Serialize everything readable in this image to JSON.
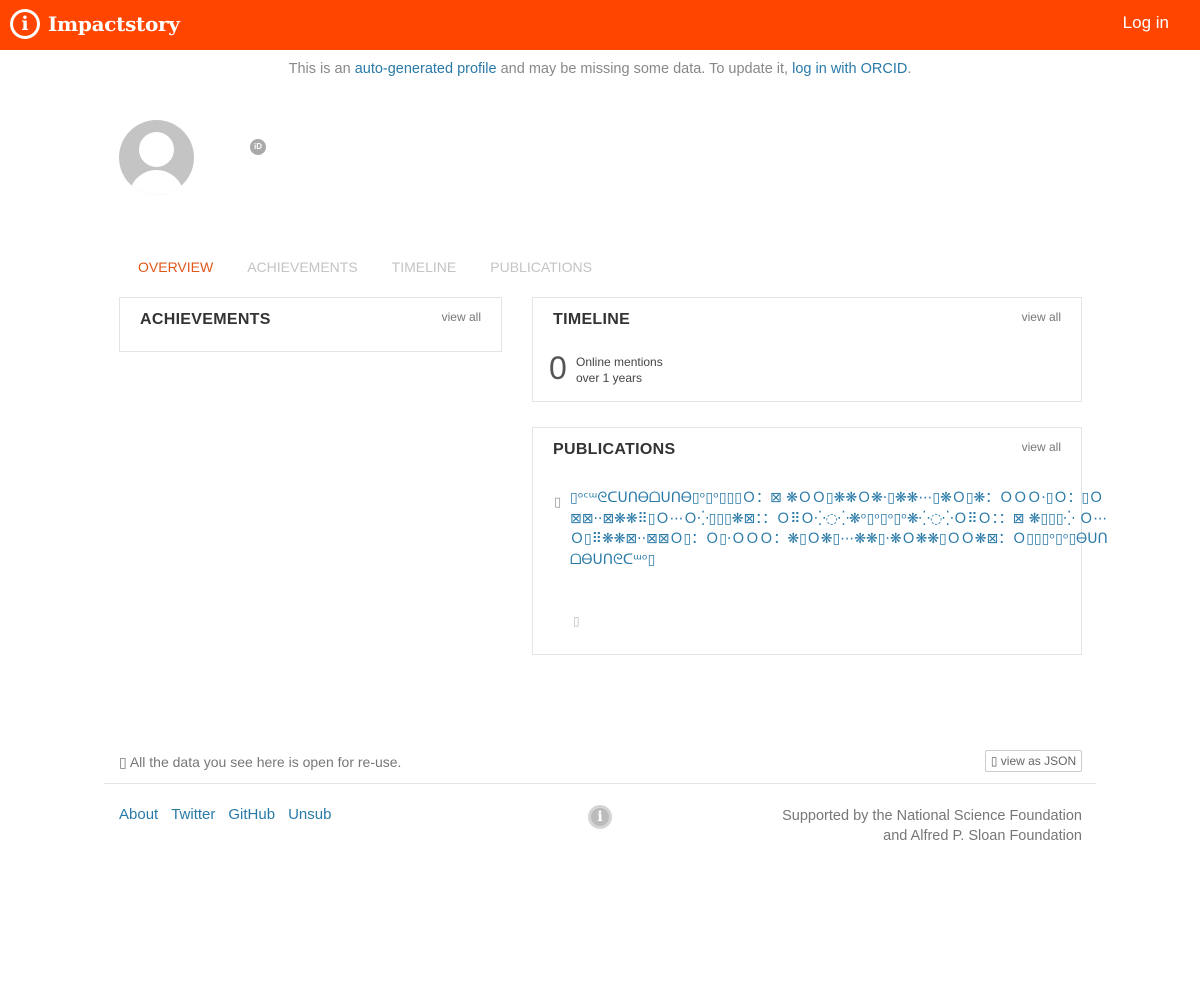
{
  "header": {
    "logo_text": "Impactstory",
    "login_label": "Log in"
  },
  "notice": {
    "prefix": "This is an ",
    "link1": "auto-generated profile",
    "middle": " and may be missing some data. To update it, ",
    "link2": "log in with ORCID",
    "suffix": "."
  },
  "profile": {
    "orcid_badge": "iD"
  },
  "tabs": [
    {
      "label": "OVERVIEW",
      "active": true
    },
    {
      "label": "ACHIEVEMENTS",
      "active": false
    },
    {
      "label": "TIMELINE",
      "active": false
    },
    {
      "label": "PUBLICATIONS",
      "active": false
    }
  ],
  "achievements": {
    "title": "ACHIEVEMENTS",
    "view_all": "view all"
  },
  "timeline": {
    "title": "TIMELINE",
    "view_all": "view all",
    "count": "0",
    "line1": "Online mentions",
    "line2": "over 1 years"
  },
  "publications": {
    "title": "PUBLICATIONS",
    "view_all": "view all",
    "icon": "▯",
    "item_title": "▯ᵒᶜᵚᘓᑕᑌᑎᎾᗝᑌᑎᎾ▯ᵒ▯ᵒ▯▯▯Ｏ：⊠ ❋ＯＯ▯❋❋Ｏ❋·▯❋❋⋯▯❋Ｏ▯❋：ＯＯＯ·▯Ｏ：▯Ｏ⊠⊠··⊠❋❋⠿▯Ｏ⋯Ｏ⁛▯▯▯❋⊠：：Ｏ⠿Ｏ⁛◌⁛❋ᵒ▯ᵒ▯ᵒ▯ᵒ❋⁛◌⁛Ｏ⠿Ｏ：：⊠ ❋▯▯▯⁛ Ｏ⋯Ｏ▯⠿❋❋⊠··⊠⊠Ｏ▯：Ｏ▯·ＯＯＯ：❋▯Ｏ❋▯⋯❋❋▯·❋Ｏ❋❋▯ＯＯ❋⊠：Ｏ▯▯▯ᵒ▯ᵒ▯ᎾᑌᑎᗝᎾᑌᑎᘓᑕᵚᵒ▯",
    "item_foot": "▯"
  },
  "footer": {
    "reuse_icon": "▯",
    "reuse_text": " All the data you see here is open for re-use.",
    "json_button": "▯ view as JSON",
    "links": [
      "About",
      "Twitter",
      "GitHub",
      "Unsub"
    ],
    "logo_glyph": "i",
    "support_line1": "Supported by the National Science Foundation",
    "support_line2": "and Alfred P. Sloan Foundation"
  }
}
